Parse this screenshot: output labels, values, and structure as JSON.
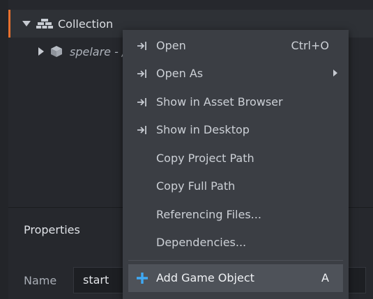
{
  "outline": {
    "collection_label": "Collection",
    "child_label": "spelare - /"
  },
  "properties": {
    "title": "Properties",
    "name_label": "Name",
    "name_value": "start"
  },
  "context_menu": {
    "items": [
      {
        "label": "Open",
        "shortcut": "Ctrl+O",
        "icon": "open-arrow-icon"
      },
      {
        "label": "Open As",
        "shortcut": "",
        "icon": "open-arrow-icon",
        "submenu": true
      },
      {
        "label": "Show in Asset Browser",
        "shortcut": "",
        "icon": "open-arrow-icon"
      },
      {
        "label": "Show in Desktop",
        "shortcut": "",
        "icon": "open-arrow-icon"
      },
      {
        "label": "Copy Project Path",
        "shortcut": ""
      },
      {
        "label": "Copy Full Path",
        "shortcut": ""
      },
      {
        "label": "Referencing Files...",
        "shortcut": ""
      },
      {
        "label": "Dependencies...",
        "shortcut": ""
      },
      {
        "label": "Add Game Object",
        "shortcut": "A",
        "icon": "plus-icon",
        "highlighted": true
      }
    ]
  },
  "colors": {
    "accent": "#e8702e",
    "plus_icon": "#3fa9f5",
    "menu_bg": "#3b3e44",
    "highlight_bg": "#4e5259",
    "panel_bg": "#26282d"
  }
}
